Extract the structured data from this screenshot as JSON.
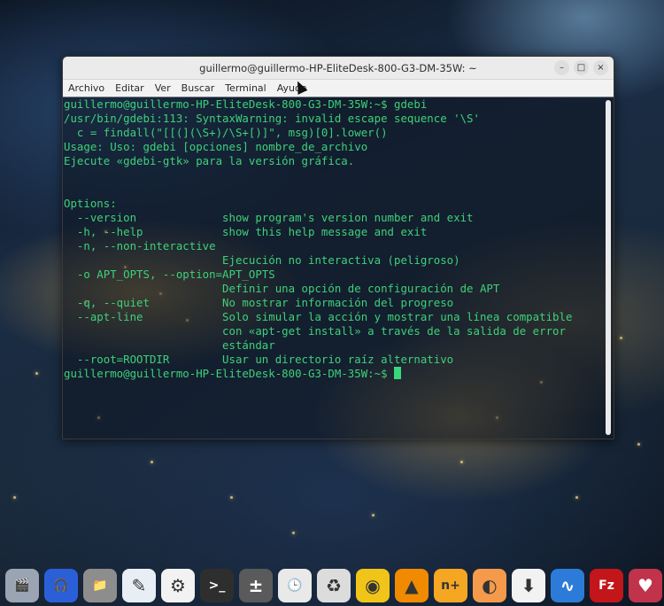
{
  "window": {
    "title": "guillermo@guillermo-HP-EliteDesk-800-G3-DM-35W: ~",
    "controls": {
      "minimize": "–",
      "maximize": "□",
      "close": "×"
    }
  },
  "menu": [
    "Archivo",
    "Editar",
    "Ver",
    "Buscar",
    "Terminal",
    "Ayuda"
  ],
  "terminal": {
    "lines": [
      "guillermo@guillermo-HP-EliteDesk-800-G3-DM-35W:~$ gdebi",
      "/usr/bin/gdebi:113: SyntaxWarning: invalid escape sequence '\\S'",
      "  c = findall(\"[[(](\\S+)/\\S+[)]\", msg)[0].lower()",
      "Usage: Uso: gdebi [opciones] nombre_de_archivo",
      "Ejecute «gdebi-gtk» para la versión gráfica.",
      "",
      "",
      "Options:",
      "  --version             show program's version number and exit",
      "  -h, --help            show this help message and exit",
      "  -n, --non-interactive",
      "                        Ejecución no interactiva (peligroso)",
      "  -o APT_OPTS, --option=APT_OPTS",
      "                        Definir una opción de configuración de APT",
      "  -q, --quiet           No mostrar información del progreso",
      "  --apt-line            Solo simular la acción y mostrar una línea compatible",
      "                        con «apt-get install» a través de la salida de error",
      "                        estándar",
      "  --root=ROOTDIR        Usar un directorio raíz alternativo"
    ],
    "prompt": "guillermo@guillermo-HP-EliteDesk-800-G3-DM-35W:~$ "
  },
  "dock": [
    {
      "name": "media-player-icon",
      "glyph": "🎬",
      "bg": "#9aa4b2"
    },
    {
      "name": "audio-editor-icon",
      "glyph": "🎧",
      "bg": "#2b5fd8"
    },
    {
      "name": "files-icon",
      "glyph": "📁",
      "bg": "#8d8d8d"
    },
    {
      "name": "text-editor-icon",
      "glyph": "✎",
      "bg": "#e8eef5"
    },
    {
      "name": "settings-toggle-icon",
      "glyph": "⚙",
      "bg": "#f2f2f2"
    },
    {
      "name": "terminal-icon",
      "glyph": ">_",
      "bg": "#2e2e2e"
    },
    {
      "name": "calculator-icon",
      "glyph": "±",
      "bg": "#5a5a5a"
    },
    {
      "name": "clock-icon",
      "glyph": "🕒",
      "bg": "#e9e9e9"
    },
    {
      "name": "trash-icon",
      "glyph": "♻",
      "bg": "#dcdcdc"
    },
    {
      "name": "music-player-icon",
      "glyph": "◉",
      "bg": "#f0c419"
    },
    {
      "name": "vlc-icon",
      "glyph": "▲",
      "bg": "#f08a00"
    },
    {
      "name": "font-app-icon",
      "glyph": "n+",
      "bg": "#f5a623"
    },
    {
      "name": "orange-app-icon",
      "glyph": "◐",
      "bg": "#f59a4a"
    },
    {
      "name": "package-installer-icon",
      "glyph": "⬇",
      "bg": "#f2f2f2"
    },
    {
      "name": "system-monitor-icon",
      "glyph": "∿",
      "bg": "#2d7bd8"
    },
    {
      "name": "filezilla-icon",
      "glyph": "Fz",
      "bg": "#c2161b"
    },
    {
      "name": "favorites-icon",
      "glyph": "♥",
      "bg": "#c0334a"
    }
  ]
}
